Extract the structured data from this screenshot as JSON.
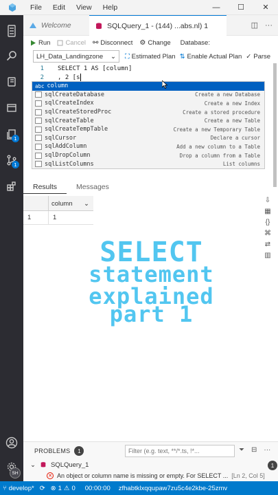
{
  "menu": [
    "File",
    "Edit",
    "View",
    "Help"
  ],
  "window_controls": {
    "minimize": "—",
    "maximize": "☐",
    "close": "✕"
  },
  "tabs": [
    {
      "label": "Welcome",
      "active": false
    },
    {
      "label": "SQLQuery_1 - (144) ...abs.nl) 1",
      "active": true
    }
  ],
  "toolbar": {
    "run": "Run",
    "cancel": "Cancel",
    "disconnect": "Disconnect",
    "change": "Change",
    "database_label": "Database:",
    "connection": "LH_Data_Landingzone",
    "estimated_plan": "Estimated Plan",
    "actual_plan": "Enable Actual Plan",
    "parse": "Parse"
  },
  "editor": {
    "lines": [
      {
        "num": "1",
        "code": "SELECT 1 AS [column]"
      },
      {
        "num": "2",
        "code": ", 2 [s"
      }
    ]
  },
  "suggestions": [
    {
      "label": "column",
      "desc": "",
      "selected": true,
      "icon": "abc"
    },
    {
      "label": "sqlCreateDatabase",
      "desc": "Create a new Database"
    },
    {
      "label": "sqlCreateIndex",
      "desc": "Create a new Index"
    },
    {
      "label": "sqlCreateStoredProc",
      "desc": "Create a stored procedure"
    },
    {
      "label": "sqlCreateTable",
      "desc": "Create a new Table"
    },
    {
      "label": "sqlCreateTempTable",
      "desc": "Create a new Temporary Table"
    },
    {
      "label": "sqlCursor",
      "desc": "Declare a cursor"
    },
    {
      "label": "sqlAddColumn",
      "desc": "Add a new column to a Table"
    },
    {
      "label": "sqlDropColumn",
      "desc": "Drop a column from a Table"
    },
    {
      "label": "sqlListColumns",
      "desc": "List columns"
    }
  ],
  "results": {
    "tabs": [
      "Results",
      "Messages"
    ],
    "column_header": "column",
    "row_number": "1",
    "row_value": "1"
  },
  "overlay": [
    "SELECT",
    "statement",
    "explained",
    "part 1"
  ],
  "panel": {
    "title": "PROBLEMS",
    "count": "1",
    "filter_placeholder": "Filter (e.g. text, **/*.ts, !*...",
    "file": "SQLQuery_1",
    "file_count": "1",
    "message": "An object or column name is missing or empty. For SELECT ...",
    "location": "[Ln 2, Col 5]"
  },
  "activity_badges": {
    "explorer": "1",
    "source_control": "1"
  },
  "avatar_initials": "SH",
  "status": {
    "branch": "develop*",
    "errors": "1",
    "warnings": "0",
    "time": "00:00:00",
    "server": "zfhabtklxqqupaw7zu5c4e2kbe-25zmv"
  },
  "colors": {
    "accent": "#007acc",
    "overlay_text": "#52c6f0",
    "activity_bar": "#2c2c32"
  }
}
